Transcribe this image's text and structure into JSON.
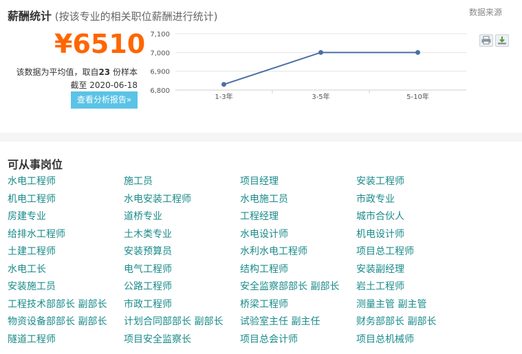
{
  "header": {
    "title": "薪酬统计",
    "subtitle": "(按该专业的相关职位薪酬进行统计)",
    "source_label": "数据来源"
  },
  "salary": {
    "value": "¥6510",
    "note_prefix": "该数据为平均值，取自",
    "sample_count": "23",
    "note_suffix": "份样本",
    "date": "截至 2020-06-18",
    "report_button": "查看分析报告»"
  },
  "toolbar": {
    "print_icon": "printer-icon",
    "download_icon": "download-icon"
  },
  "chart_data": {
    "type": "line",
    "categories": [
      "1-3年",
      "3-5年",
      "5-10年"
    ],
    "values": [
      6830,
      7000,
      7000
    ],
    "yticks": [
      "7,100",
      "7,000",
      "6,900",
      "6,800"
    ],
    "ylim": [
      6800,
      7100
    ],
    "grid": true,
    "color": "#4a6fa5"
  },
  "jobs_section": {
    "title": "可从事岗位",
    "items": [
      "水电工程师",
      "施工员",
      "项目经理",
      "安装工程师",
      "机电工程师",
      "水电安装工程师",
      "水电施工员",
      "市政专业",
      "房建专业",
      "道桥专业",
      "工程经理",
      "城市合伙人",
      "给排水工程师",
      "土木类专业",
      "水电设计师",
      "机电设计师",
      "土建工程师",
      "安装预算员",
      "水利水电工程师",
      "项目总工程师",
      "水电工长",
      "电气工程师",
      "结构工程师",
      "安装副经理",
      "安装施工员",
      "公路工程师",
      "安全监察部部长 副部长",
      "岩土工程师",
      "工程技术部部长 副部长",
      "市政工程师",
      "桥梁工程师",
      "测量主管 副主管",
      "物资设备部部长 副部长",
      "计划合同部部长 副部长",
      "试验室主任 副主任",
      "财务部部长 副部长",
      "隧道工程师",
      "项目安全监察长",
      "项目总会计师",
      "项目总机械师"
    ]
  }
}
